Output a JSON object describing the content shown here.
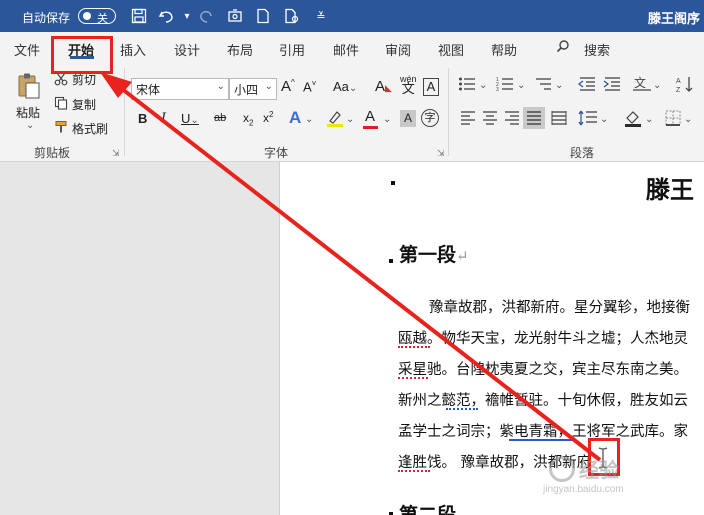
{
  "titlebar": {
    "autosave_label": "自动保存",
    "autosave_state": "关",
    "document_title": "滕王阁序",
    "accent_color": "#2b579a",
    "quick_access_icons": [
      "save-icon",
      "undo-icon",
      "redo-icon",
      "touch-mode-icon",
      "new-document-icon",
      "print-preview-icon",
      "customize-icon"
    ]
  },
  "tabs": [
    {
      "label": "文件"
    },
    {
      "label": "开始",
      "active": true
    },
    {
      "label": "插入"
    },
    {
      "label": "设计"
    },
    {
      "label": "布局"
    },
    {
      "label": "引用"
    },
    {
      "label": "邮件"
    },
    {
      "label": "审阅"
    },
    {
      "label": "视图"
    },
    {
      "label": "帮助"
    }
  ],
  "search": {
    "label": "搜索"
  },
  "ribbon": {
    "clipboard": {
      "group_label": "剪贴板",
      "paste_label": "粘贴",
      "cut_label": "剪切",
      "copy_label": "复制",
      "format_painter_label": "格式刷"
    },
    "font": {
      "group_label": "字体",
      "font_name": "宋体",
      "font_size": "小四",
      "buttons": [
        "A^",
        "A˅",
        "Aa",
        "A",
        "文",
        "A",
        "B",
        "I",
        "U",
        "abc",
        "x₂",
        "x²",
        "A",
        "ab",
        "A",
        "A",
        "字"
      ]
    },
    "paragraph": {
      "group_label": "段落"
    }
  },
  "document": {
    "title": "滕王",
    "heading1": "第一段",
    "heading2": "第二段",
    "paragraph_lines": [
      "豫章故郡，洪都新府。星分翼轸，地接衡",
      "瓯越。物华天宝，龙光射牛斗之墟；人杰地灵",
      "采星驰。台隍枕夷夏之交，宾主尽东南之美。",
      "新州之懿范，襜帷暂驻。十旬休假，胜友如云",
      "孟学士之词宗；紫电青霜，王将军之武库。家",
      "逢胜饯。 豫章故郡，洪都新府"
    ],
    "paragraph_mark": "↵"
  },
  "overlay": {
    "arrow_color": "#e8221c"
  },
  "watermark": {
    "text": "经验",
    "url": "jingyan.baidu.com"
  }
}
